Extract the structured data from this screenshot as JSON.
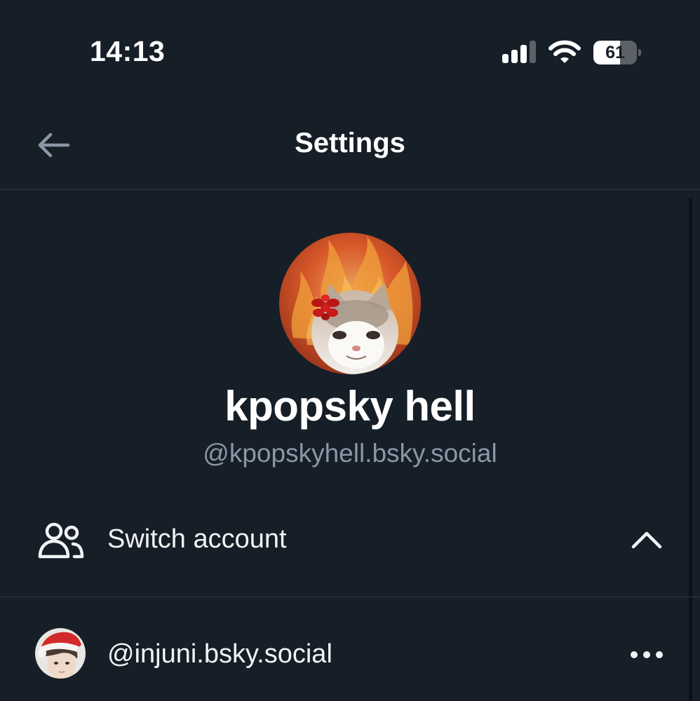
{
  "status_bar": {
    "time": "14:13",
    "battery_percent": "61",
    "battery_level": 0.61,
    "signal_bars_active": 3,
    "signal_bars_total": 4,
    "icons": [
      "signal-icon",
      "wifi-icon",
      "battery-icon"
    ]
  },
  "header": {
    "title": "Settings",
    "back_icon": "arrow-left-icon"
  },
  "profile": {
    "display_name": "kpopsky hell",
    "handle": "@kpopskyhell.bsky.social"
  },
  "switch_account": {
    "label": "Switch account",
    "icon": "users-icon",
    "expanded_icon": "chevron-up-icon"
  },
  "accounts": [
    {
      "handle": "@injuni.bsky.social",
      "menu_icon": "more-dots-icon"
    }
  ],
  "colors": {
    "background": "#161e27",
    "text": "#ffffff",
    "muted": "#8b97a6",
    "divider": "#2c3844"
  }
}
